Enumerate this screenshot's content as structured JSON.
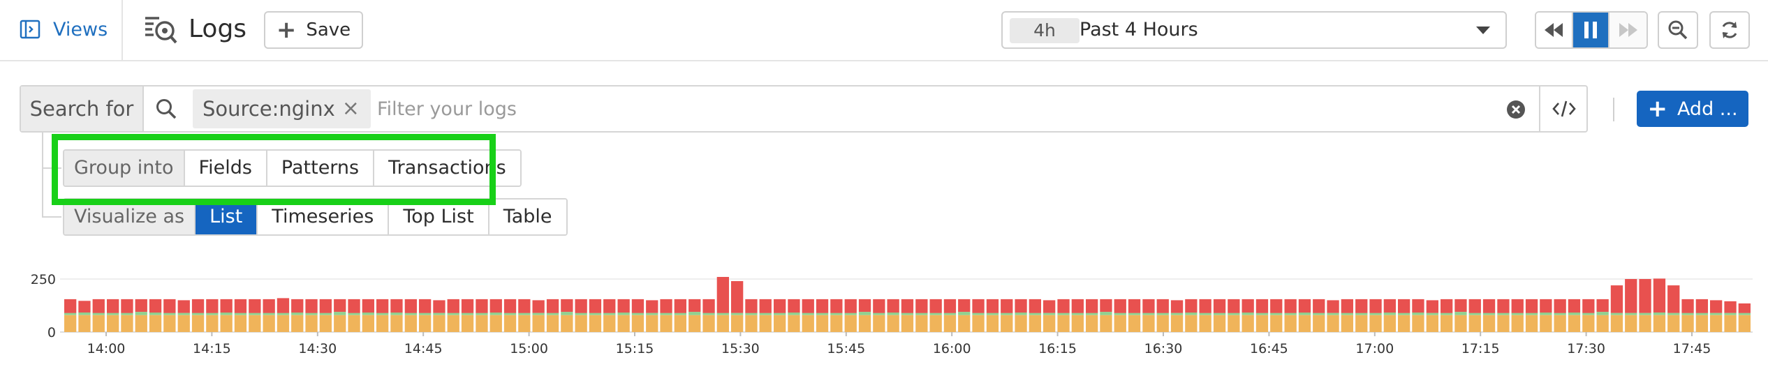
{
  "topbar": {
    "views_label": "Views",
    "title": "Logs",
    "save_label": "Save",
    "time_badge": "4h",
    "time_label": "Past 4 Hours"
  },
  "search": {
    "search_for_label": "Search for",
    "facet_pill": "Source:nginx",
    "placeholder": "Filter your logs",
    "add_label": "Add ..."
  },
  "group_into": {
    "label": "Group into",
    "options": [
      "Fields",
      "Patterns",
      "Transactions"
    ]
  },
  "visualize_as": {
    "label": "Visualize as",
    "options": [
      "List",
      "Timeseries",
      "Top List",
      "Table"
    ],
    "selected": "List"
  },
  "icons": {
    "views": "panel-icon",
    "logs": "logs-icon",
    "save": "plus-icon",
    "search": "search-icon",
    "pill_close": "close-icon",
    "clear": "clear-circle-icon",
    "code": "code-icon",
    "rewind": "rewind-icon",
    "pause": "pause-icon",
    "forward": "fast-forward-icon",
    "zoom_out": "zoom-out-icon",
    "refresh": "refresh-icon"
  },
  "colors": {
    "accent": "#1565c0",
    "error": "#e8514f",
    "warn": "#f0b45a",
    "info": "#8fd18f",
    "highlight": "#18d018"
  },
  "chart_data": {
    "type": "bar",
    "stacked": true,
    "y_ticks": [
      "250",
      "0"
    ],
    "ylim": [
      0,
      250
    ],
    "x_ticks": [
      "14:00",
      "14:15",
      "14:30",
      "14:45",
      "15:00",
      "15:15",
      "15:30",
      "15:45",
      "16:00",
      "16:15",
      "16:30",
      "16:45",
      "17:00",
      "17:15",
      "17:30",
      "17:45"
    ],
    "series": [
      {
        "color": "#f0b45a",
        "values": [
          80,
          80,
          80,
          80,
          80,
          80,
          80,
          80,
          80,
          80,
          80,
          80,
          80,
          80,
          80,
          80,
          80,
          80,
          80,
          80,
          80,
          80,
          80,
          80,
          80,
          80,
          80,
          80,
          80,
          80,
          80,
          80,
          80,
          80,
          80,
          80,
          80,
          80,
          80,
          80,
          80,
          80,
          80,
          80,
          80,
          80,
          80,
          80,
          80,
          80,
          80,
          80,
          80,
          80,
          80,
          80,
          80,
          80,
          80,
          80,
          80,
          80,
          80,
          80,
          80,
          80,
          80,
          80,
          80,
          80,
          80,
          80,
          80,
          80,
          80,
          80,
          80,
          80,
          80,
          80,
          80,
          80,
          80,
          80,
          80,
          80,
          80,
          80,
          80,
          80,
          80,
          80,
          80,
          80,
          80,
          80,
          80,
          80,
          80,
          80,
          80,
          80,
          80,
          80,
          80,
          80,
          80,
          80,
          80,
          80,
          80,
          80,
          80,
          80,
          80,
          80,
          80,
          80,
          80
        ]
      },
      {
        "color": "#8fd18f",
        "values": [
          10,
          12,
          10,
          10,
          10,
          15,
          12,
          10,
          10,
          10,
          10,
          12,
          10,
          10,
          10,
          10,
          12,
          10,
          10,
          15,
          10,
          12,
          10,
          12,
          10,
          10,
          10,
          10,
          10,
          10,
          12,
          10,
          10,
          10,
          10,
          15,
          10,
          10,
          10,
          12,
          10,
          10,
          10,
          10,
          15,
          10,
          10,
          10,
          10,
          10,
          10,
          12,
          10,
          10,
          10,
          10,
          15,
          10,
          12,
          10,
          10,
          10,
          10,
          15,
          10,
          10,
          10,
          12,
          10,
          10,
          10,
          10,
          10,
          15,
          10,
          10,
          10,
          10,
          10,
          12,
          10,
          10,
          10,
          12,
          10,
          10,
          10,
          12,
          10,
          10,
          10,
          10,
          10,
          12,
          10,
          12,
          10,
          10,
          15,
          10,
          10,
          10,
          10,
          10,
          12,
          10,
          12,
          10,
          15,
          10,
          10,
          10,
          12,
          10,
          10,
          10,
          10,
          10,
          10
        ]
      },
      {
        "color": "#e8514f",
        "values": [
          65,
          55,
          65,
          65,
          65,
          60,
          63,
          65,
          60,
          65,
          65,
          63,
          65,
          65,
          65,
          70,
          63,
          65,
          65,
          60,
          65,
          63,
          65,
          63,
          65,
          65,
          60,
          65,
          65,
          65,
          63,
          65,
          65,
          60,
          65,
          60,
          65,
          65,
          65,
          63,
          65,
          60,
          65,
          65,
          60,
          65,
          65,
          65,
          65,
          65,
          65,
          63,
          65,
          65,
          65,
          65,
          60,
          65,
          63,
          65,
          65,
          65,
          65,
          60,
          65,
          65,
          65,
          63,
          65,
          60,
          65,
          65,
          65,
          60,
          65,
          65,
          65,
          65,
          60,
          63,
          65,
          65,
          65,
          63,
          65,
          65,
          65,
          63,
          65,
          60,
          65,
          65,
          65,
          63,
          65,
          63,
          60,
          65,
          60,
          65,
          65,
          65,
          65,
          65,
          63,
          65,
          63,
          65,
          60,
          65,
          65,
          65,
          63,
          65,
          65,
          65,
          60,
          55,
          45
        ]
      }
    ],
    "spikes": {
      "46": 170,
      "47": 150,
      "109": 130,
      "110": 160,
      "111": 160,
      "112": 160,
      "113": 130
    }
  }
}
